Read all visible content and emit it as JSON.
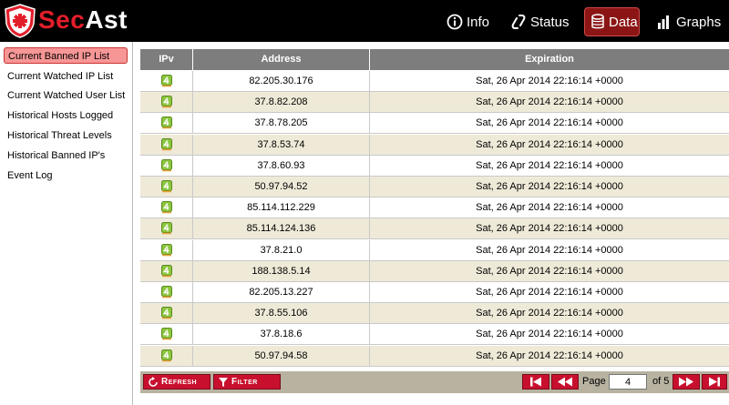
{
  "app": {
    "brand_part1": "Sec",
    "brand_part2": "Ast",
    "brand_color": "#e21e2a"
  },
  "nav": [
    {
      "label": "Info",
      "icon": "info-icon"
    },
    {
      "label": "Status",
      "icon": "link-icon"
    },
    {
      "label": "Data",
      "icon": "database-icon",
      "active": true
    },
    {
      "label": "Graphs",
      "icon": "bar-chart-icon"
    }
  ],
  "sidebar": {
    "items": [
      {
        "label": "Current Banned IP List",
        "active": true
      },
      {
        "label": "Current Watched IP List"
      },
      {
        "label": "Current Watched User List"
      },
      {
        "label": "Historical Hosts Logged"
      },
      {
        "label": "Historical Threat Levels"
      },
      {
        "label": "Historical Banned IP's"
      },
      {
        "label": "Event Log"
      }
    ]
  },
  "table": {
    "columns": [
      "IPv",
      "Address",
      "Expiration"
    ],
    "ipv_icon": "ipv4-icon",
    "rows": [
      {
        "address": "82.205.30.176",
        "expiration": "Sat, 26 Apr 2014 22:16:14 +0000"
      },
      {
        "address": "37.8.82.208",
        "expiration": "Sat, 26 Apr 2014 22:16:14 +0000"
      },
      {
        "address": "37.8.78.205",
        "expiration": "Sat, 26 Apr 2014 22:16:14 +0000"
      },
      {
        "address": "37.8.53.74",
        "expiration": "Sat, 26 Apr 2014 22:16:14 +0000"
      },
      {
        "address": "37.8.60.93",
        "expiration": "Sat, 26 Apr 2014 22:16:14 +0000"
      },
      {
        "address": "50.97.94.52",
        "expiration": "Sat, 26 Apr 2014 22:16:14 +0000"
      },
      {
        "address": "85.114.112.229",
        "expiration": "Sat, 26 Apr 2014 22:16:14 +0000"
      },
      {
        "address": "85.114.124.136",
        "expiration": "Sat, 26 Apr 2014 22:16:14 +0000"
      },
      {
        "address": "37.8.21.0",
        "expiration": "Sat, 26 Apr 2014 22:16:14 +0000"
      },
      {
        "address": "188.138.5.14",
        "expiration": "Sat, 26 Apr 2014 22:16:14 +0000"
      },
      {
        "address": "82.205.13.227",
        "expiration": "Sat, 26 Apr 2014 22:16:14 +0000"
      },
      {
        "address": "37.8.55.106",
        "expiration": "Sat, 26 Apr 2014 22:16:14 +0000"
      },
      {
        "address": "37.8.18.6",
        "expiration": "Sat, 26 Apr 2014 22:16:14 +0000"
      },
      {
        "address": "50.97.94.58",
        "expiration": "Sat, 26 Apr 2014 22:16:14 +0000"
      }
    ]
  },
  "toolbar": {
    "refresh_label": "Refresh",
    "filter_label": "Filter",
    "page_label": "Page",
    "page_value": "4",
    "page_of": "of 5"
  }
}
